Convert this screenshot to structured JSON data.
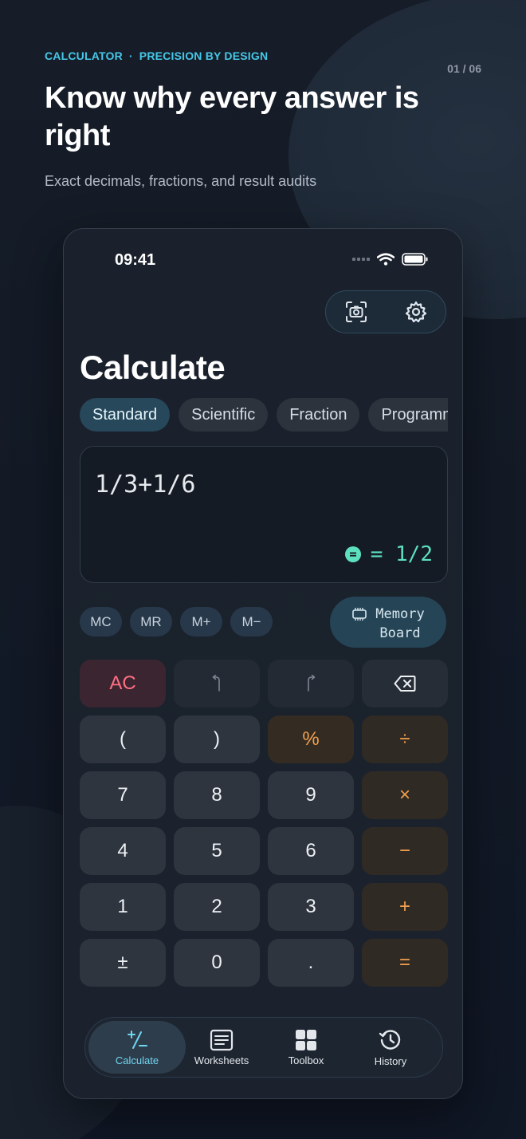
{
  "header": {
    "kicker_left": "CALCULATOR",
    "kicker_sep": "·",
    "kicker_right": "PRECISION BY DESIGN",
    "pager": "01 / 06",
    "headline": "Know why every answer is right",
    "subhead": "Exact decimals, fractions, and result audits"
  },
  "status": {
    "time": "09:41"
  },
  "icons": {
    "camera": "camera-scan-icon",
    "settings": "gear-icon"
  },
  "screen": {
    "title": "Calculate",
    "modes": [
      {
        "label": "Standard",
        "active": true
      },
      {
        "label": "Scientific",
        "active": false
      },
      {
        "label": "Fraction",
        "active": false
      },
      {
        "label": "Programmer",
        "active": false
      }
    ],
    "expression": "1/3+1/6",
    "result": "= 1/2",
    "memory": [
      "MC",
      "MR",
      "M+",
      "M−"
    ],
    "memory_board_line1": "Memory",
    "memory_board_line2": "Board"
  },
  "keys": {
    "ac": "AC",
    "lparen": "(",
    "rparen": ")",
    "percent": "%",
    "divide": "÷",
    "k7": "7",
    "k8": "8",
    "k9": "9",
    "multiply": "×",
    "k4": "4",
    "k5": "5",
    "k6": "6",
    "minus": "−",
    "k1": "1",
    "k2": "2",
    "k3": "3",
    "plus": "+",
    "plusminus": "±",
    "k0": "0",
    "dot": ".",
    "equals": "="
  },
  "tabbar": [
    {
      "label": "Calculate",
      "icon": "plus-minus-icon",
      "active": true
    },
    {
      "label": "Worksheets",
      "icon": "worksheet-icon",
      "active": false
    },
    {
      "label": "Toolbox",
      "icon": "grid-icon",
      "active": false
    },
    {
      "label": "History",
      "icon": "history-icon",
      "active": false
    }
  ],
  "colors": {
    "accent": "#46c8e8",
    "result": "#5de0be",
    "operator": "#f2a04e",
    "clear": "#ff6f83"
  }
}
